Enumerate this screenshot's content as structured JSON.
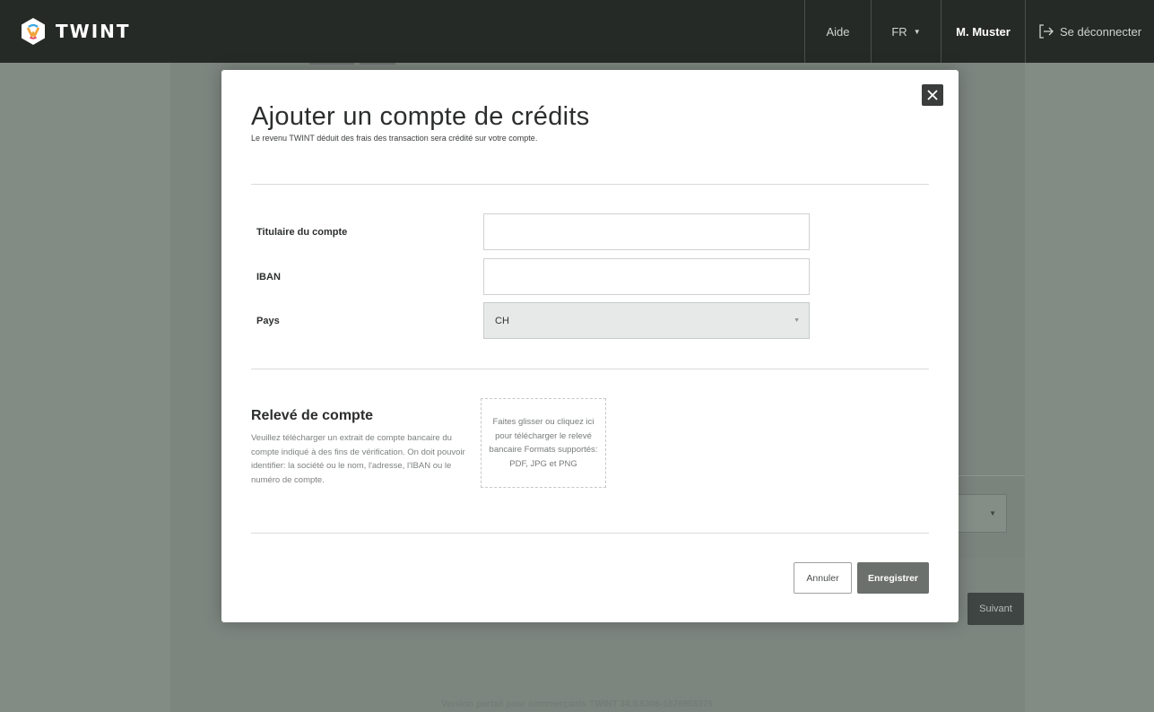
{
  "header": {
    "brand": "TWINT",
    "logo_icon": "twint-logo-icon",
    "nav": {
      "help": "Aide",
      "language": "FR",
      "user": "M. Muster",
      "logout": "Se déconnecter",
      "logout_icon": "logout-icon"
    }
  },
  "background": {
    "next_button": "Suivant",
    "version": "Version portail pour commerçants TWINT 34.0.6306-1676958375"
  },
  "modal": {
    "title": "Ajouter un compte de crédits",
    "subtitle": "Le revenu TWINT déduit des frais des transaction sera crédité sur votre compte.",
    "close_icon": "close-icon",
    "fields": {
      "holder_label": "Titulaire du compte",
      "holder_value": "",
      "iban_label": "IBAN",
      "iban_value": "",
      "country_label": "Pays",
      "country_value": "CH"
    },
    "statement": {
      "heading": "Relevé de compte",
      "description": "Veuillez télécharger un extrait de compte bancaire du compte indiqué à  des fins de vérification. On doit pouvoir identifier: la société ou le nom, l'adresse, l'IBAN ou le numéro de compte.",
      "dropzone": "Faites glisser ou cliquez ici pour télécharger le relevé bancaire Formats supportés: PDF, JPG et PNG"
    },
    "buttons": {
      "cancel": "Annuler",
      "save": "Enregistrer"
    }
  }
}
